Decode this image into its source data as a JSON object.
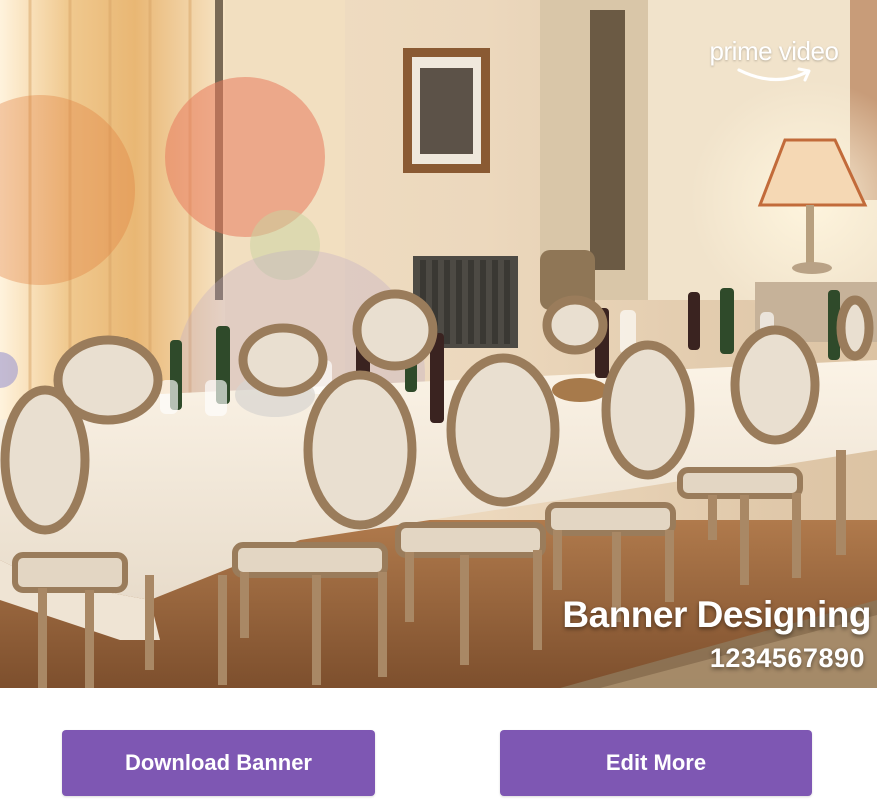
{
  "banner": {
    "brand": "prime video",
    "title": "Banner Designing",
    "number": "1234567890"
  },
  "actions": {
    "download_label": "Download Banner",
    "edit_label": "Edit More"
  },
  "colors": {
    "button_bg": "#7e57b3",
    "button_text": "#ffffff",
    "banner_text": "#ffffff"
  },
  "icons": {
    "brand": "prime-video-smile-logo"
  }
}
